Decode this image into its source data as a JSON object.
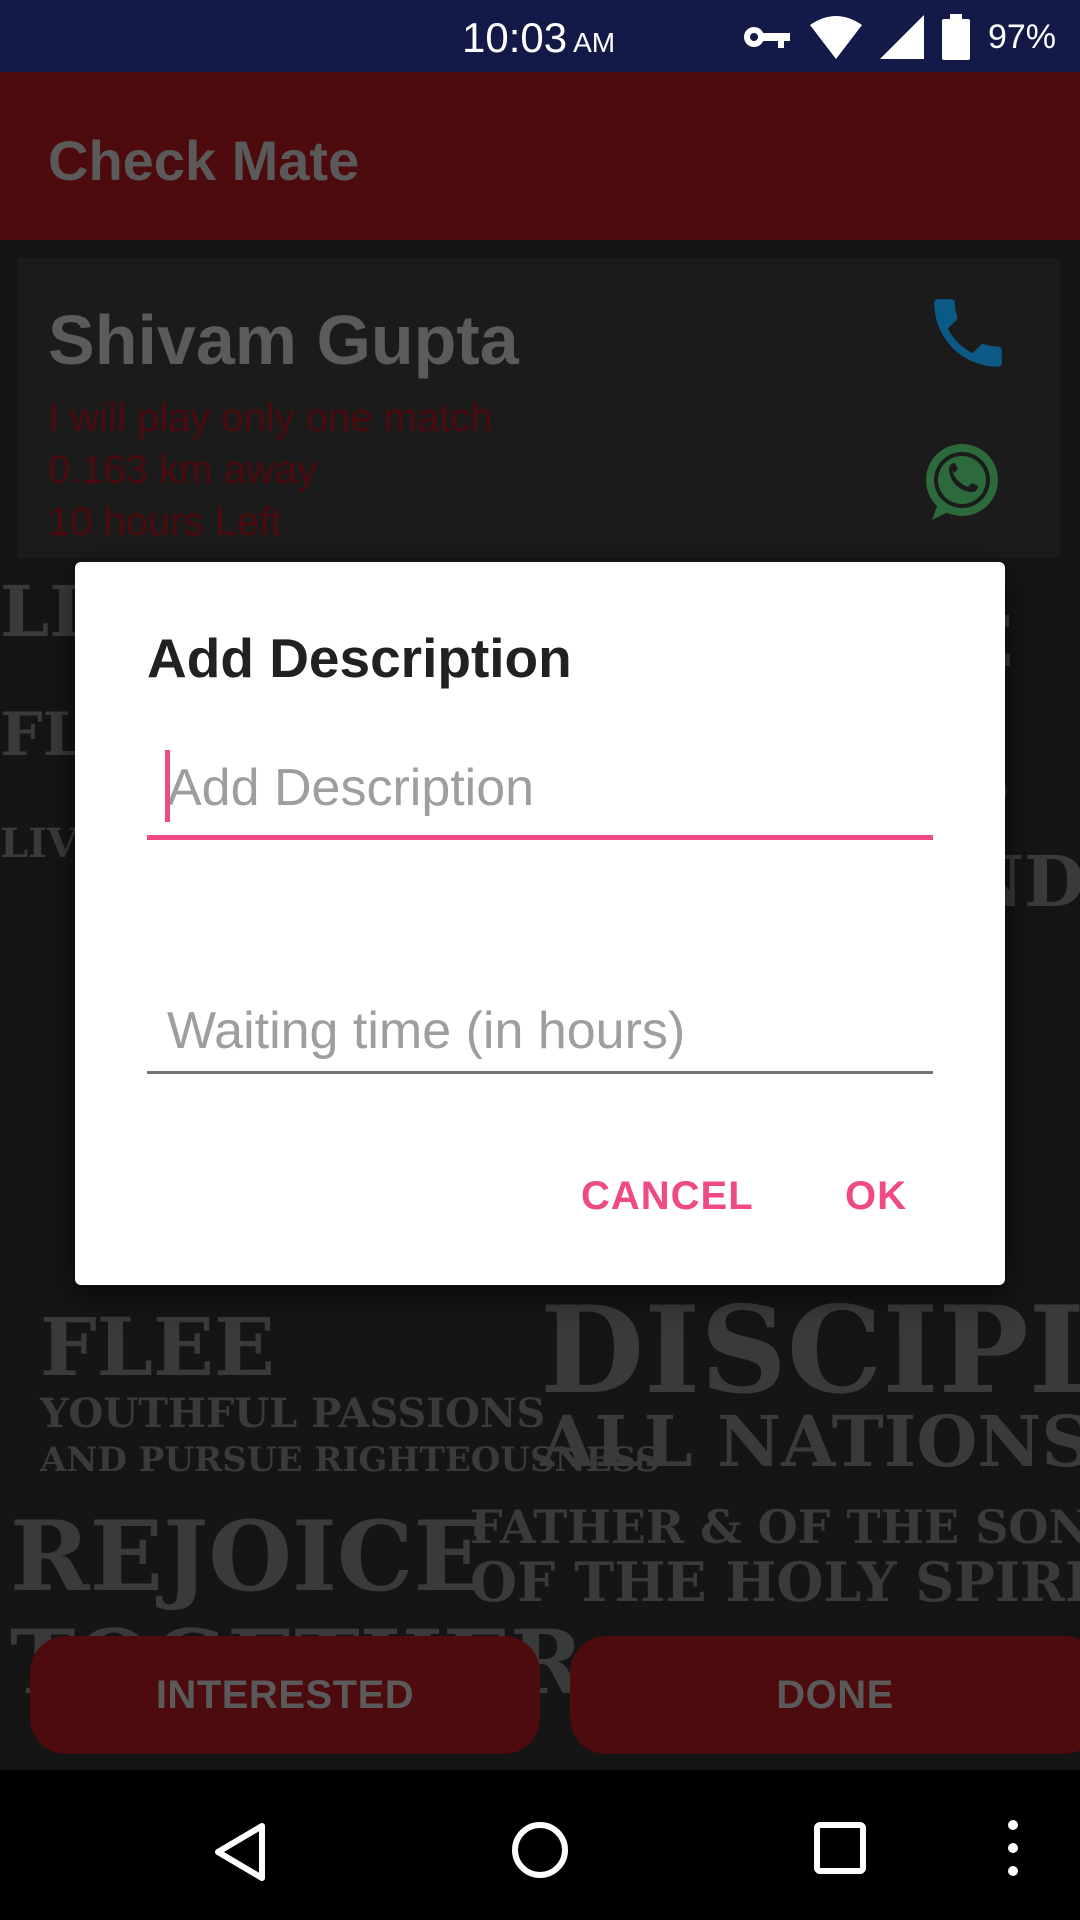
{
  "status_bar": {
    "time": "10:03",
    "ampm": "AM",
    "battery_percent": "97%",
    "icons": [
      "vpn-key-icon",
      "wifi-icon",
      "signal-icon",
      "battery-icon"
    ]
  },
  "app_bar": {
    "title": "Check Mate"
  },
  "card": {
    "name": "Shivam Gupta",
    "description": "I will play only one match",
    "distance": "0.163 km away",
    "time_left": "10 hours Left",
    "actions": [
      "phone-icon",
      "whatsapp-icon"
    ]
  },
  "dialog": {
    "title": "Add Description",
    "description_placeholder": "Add Description",
    "description_value": "",
    "waiting_time_placeholder": "Waiting time (in hours)",
    "waiting_time_value": "",
    "cancel_label": "CANCEL",
    "ok_label": "OK"
  },
  "bottom_buttons": {
    "interested_label": "INTERESTED",
    "done_label": "DONE"
  },
  "nav_bar": {
    "icons": [
      "back-icon",
      "home-icon",
      "recents-icon",
      "more-icon"
    ]
  },
  "colors": {
    "status_bar": "#141a47",
    "app_bar": "#4d0b0d",
    "accent": "#ef4a86",
    "phone_icon": "#0b5a86",
    "whatsapp_icon": "#2d6a3b"
  }
}
